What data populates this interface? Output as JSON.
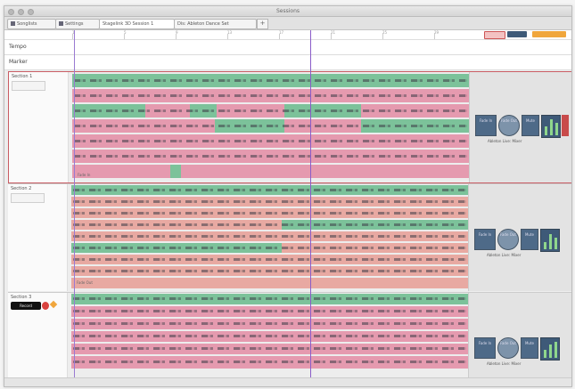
{
  "window": {
    "title": "Sessions",
    "tabs": [
      {
        "label": "Songlists",
        "active": false
      },
      {
        "label": "Settings",
        "active": false
      },
      {
        "label": "Stagelink 3D Session 1",
        "active": true
      },
      {
        "label": "Dis: Ableton Dance Set",
        "active": false
      }
    ],
    "add_tab_label": "+"
  },
  "ruler": {
    "ticks": [
      "1",
      "5",
      "9",
      "13",
      "17",
      "21",
      "25",
      "29",
      "33",
      "37",
      "41"
    ]
  },
  "rows": {
    "tempo_label": "Tempo",
    "marker_label": "Marker"
  },
  "sections": [
    {
      "name": "Section 1",
      "panel_caption": "Ableton Live: Mixer",
      "footer_text": "Fade In",
      "lanes": [
        {
          "color": "green"
        },
        {
          "color": "pink"
        },
        {
          "color": "pink"
        },
        {
          "color": "pink"
        },
        {
          "color": "pink"
        },
        {
          "color": "pink"
        },
        {
          "color": "pink"
        }
      ]
    },
    {
      "name": "Section 2",
      "panel_caption": "Ableton Live: Mixer",
      "footer_text": "Fade Out",
      "lanes": [
        {
          "color": "green"
        },
        {
          "color": "peach"
        },
        {
          "color": "peach"
        },
        {
          "color": "peach"
        },
        {
          "color": "peach"
        },
        {
          "color": "peach"
        },
        {
          "color": "peach"
        },
        {
          "color": "peach"
        }
      ]
    },
    {
      "name": "Section 3",
      "panel_caption": "Ableton Live: Mixer",
      "badge": "Record",
      "lanes": [
        {
          "color": "green"
        },
        {
          "color": "pink"
        },
        {
          "color": "pink"
        },
        {
          "color": "pink"
        },
        {
          "color": "pink"
        },
        {
          "color": "pink"
        }
      ]
    }
  ],
  "panel_buttons": [
    "Fade In",
    "Fade Out",
    "Mute"
  ],
  "colors": {
    "green": "#7cc29a",
    "pink": "#e59aaf",
    "peach": "#e8a9a2",
    "section_border": "#c95c63",
    "playhead": "#8a5cc8",
    "panel_blue": "#4e6a88"
  }
}
